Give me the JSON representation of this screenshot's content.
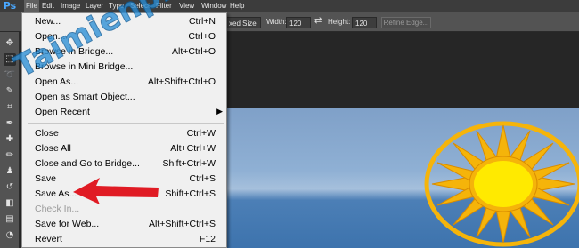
{
  "app": {
    "logo": "Ps"
  },
  "menubar": {
    "items": [
      {
        "label": "File"
      },
      {
        "label": "Edit"
      },
      {
        "label": "Image"
      },
      {
        "label": "Layer"
      },
      {
        "label": "Type"
      },
      {
        "label": "Select"
      },
      {
        "label": "Filter"
      },
      {
        "label": "View"
      },
      {
        "label": "Window"
      },
      {
        "label": "Help"
      }
    ]
  },
  "options": {
    "style_value": "xed Size",
    "width_label": "Width:",
    "width_value": "120 px",
    "height_label": "Height:",
    "height_value": "120 px",
    "refine_edge": "Refine Edge..."
  },
  "file_menu": {
    "groups": [
      [
        {
          "label": "New...",
          "shortcut": "Ctrl+N"
        },
        {
          "label": "Open...",
          "shortcut": "Ctrl+O"
        },
        {
          "label": "Browse in Bridge...",
          "shortcut": "Alt+Ctrl+O"
        },
        {
          "label": "Browse in Mini Bridge...",
          "shortcut": ""
        },
        {
          "label": "Open As...",
          "shortcut": "Alt+Shift+Ctrl+O"
        },
        {
          "label": "Open as Smart Object...",
          "shortcut": ""
        },
        {
          "label": "Open Recent",
          "shortcut": ""
        }
      ],
      [
        {
          "label": "Close",
          "shortcut": "Ctrl+W"
        },
        {
          "label": "Close All",
          "shortcut": "Alt+Ctrl+W"
        },
        {
          "label": "Close and Go to Bridge...",
          "shortcut": "Shift+Ctrl+W"
        },
        {
          "label": "Save",
          "shortcut": "Ctrl+S"
        },
        {
          "label": "Save As...",
          "shortcut": "Shift+Ctrl+S"
        },
        {
          "label": "Check In...",
          "shortcut": ""
        },
        {
          "label": "Save for Web...",
          "shortcut": "Alt+Shift+Ctrl+S"
        },
        {
          "label": "Revert",
          "shortcut": "F12"
        }
      ]
    ]
  },
  "watermark": {
    "text": "Taimienphi.vn"
  },
  "colors": {
    "annotation_arrow": "#e01b24",
    "photo_sun": "#ffea00",
    "photo_rays": "#f5b40a"
  }
}
